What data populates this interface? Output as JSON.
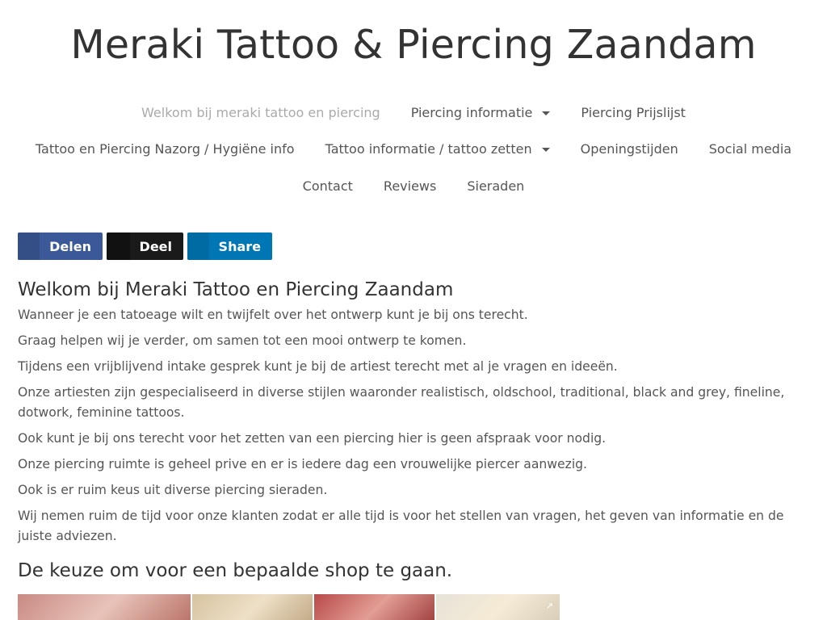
{
  "site": {
    "title": "Meraki Tattoo & Piercing Zaandam"
  },
  "nav": {
    "row1": [
      {
        "label": "Welkom bij meraki tattoo en piercing",
        "active": true
      },
      {
        "label": "Piercing informatie",
        "dropdown": true
      },
      {
        "label": "Piercing Prijslijst"
      }
    ],
    "row2": [
      {
        "label": "Tattoo en Piercing Nazorg / Hygiëne info"
      },
      {
        "label": "Tattoo informatie / tattoo zetten",
        "dropdown": true
      },
      {
        "label": "Openingstijden"
      },
      {
        "label": "Social media"
      }
    ],
    "row3": [
      {
        "label": "Contact"
      },
      {
        "label": "Reviews"
      },
      {
        "label": "Sieraden"
      }
    ]
  },
  "share": {
    "facebook": {
      "label": "Delen",
      "icon": "facebook-icon",
      "color": "#3b5998"
    },
    "x": {
      "label": "Deel",
      "icon": "x-icon",
      "color": "#1a1a1a"
    },
    "linkedin": {
      "label": "Share",
      "icon": "linkedin-icon",
      "color": "#0077b5"
    }
  },
  "content": {
    "heading": "Welkom bij Meraki Tattoo en Piercing Zaandam",
    "paragraphs": [
      "Wanneer je een tatoeage wilt en twijfelt over het ontwerp kunt je bij ons terecht.",
      "Graag helpen wij je verder, om samen tot een mooi ontwerp te komen.",
      "Tijdens een vrijblijvend intake gesprek kunt je bij de artiest terecht met al je vragen en ideeën.",
      "Onze artiesten zijn gespecialiseerd in diverse stijlen waaronder realistisch, oldschool, traditional, black and grey, fineline, dotwork, feminine tattoos.",
      "Ook kunt je bij ons terecht voor het zetten van een piercing hier is geen afspraak voor nodig.",
      "Onze piercing ruimte is geheel prive en er is iedere dag een vrouwelijke piercer aanwezig.",
      "Ook is er  ruim keus uit diverse piercing sieraden.",
      "Wij nemen ruim de tijd voor onze klanten zodat er alle tijd is voor het stellen van vragen, het geven van informatie en de juiste adviezen."
    ],
    "subheading": "De keuze om voor een bepaalde shop te gaan."
  },
  "gallery": {
    "expand_icon": "expand-icon"
  }
}
